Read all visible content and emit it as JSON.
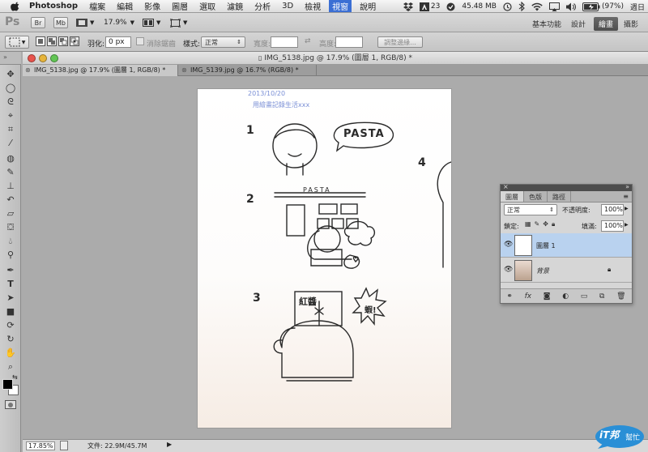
{
  "menubar": {
    "app_name": "Photoshop",
    "menus": [
      "檔案",
      "編輯",
      "影像",
      "圖層",
      "選取",
      "濾鏡",
      "分析",
      "3D",
      "檢視",
      "視窗",
      "說明"
    ],
    "active_menu": "視窗",
    "status": {
      "adobe_count": "23",
      "memory": "45.48 MB",
      "battery": "(97%)",
      "day": "週日"
    }
  },
  "appbar": {
    "ps_logo": "Ps",
    "br_label": "Br",
    "mb_label": "Mb",
    "zoom": "17.9%",
    "workspaces": [
      "基本功能",
      "設計",
      "繪畫",
      "攝影"
    ],
    "active_workspace": "繪畫"
  },
  "optbar": {
    "feather_label": "羽化:",
    "feather_value": "0 px",
    "antialias_label": "消除鋸齒",
    "style_label": "樣式:",
    "style_value": "正常",
    "width_label": "寬度:",
    "height_label": "高度:",
    "refine_button": "調整邊緣..."
  },
  "document": {
    "window_title": "IMG_5138.jpg @ 17.9% (圖層 1, RGB/8) *",
    "tabs": [
      {
        "label": "IMG_5138.jpg @ 17.9% (圖層 1, RGB/8) *",
        "active": true
      },
      {
        "label": "IMG_5139.jpg @ 16.7% (RGB/8) *",
        "active": false
      }
    ],
    "drawing_text": {
      "date": "2013/10/20",
      "caption": "用繪畫記錄生活xxx",
      "num1": "1",
      "bubble": "PASTA",
      "num2": "2",
      "sign": "PASTA",
      "num3": "3",
      "num4": "4",
      "sign3": "紅醬",
      "shout": "蝦!"
    }
  },
  "statusbar": {
    "zoom": "17.85%",
    "doc_size": "文件: 22.9M/45.7M"
  },
  "layers_panel": {
    "tabs": [
      "圖層",
      "色版",
      "路徑"
    ],
    "blend_mode": "正常",
    "opacity_label": "不透明度:",
    "opacity_value": "100%",
    "lock_label": "鎖定:",
    "fill_label": "填滿:",
    "fill_value": "100%",
    "layers": [
      {
        "name": "圖層 1",
        "selected": true
      },
      {
        "name": "背景",
        "selected": false
      }
    ]
  },
  "watermark": {
    "text": "iT邦",
    "sub": "幫忙"
  },
  "colors": {
    "accent": "#3b6fd4",
    "selected_layer": "#b9d2ef",
    "badge": "#2a8fd6"
  }
}
